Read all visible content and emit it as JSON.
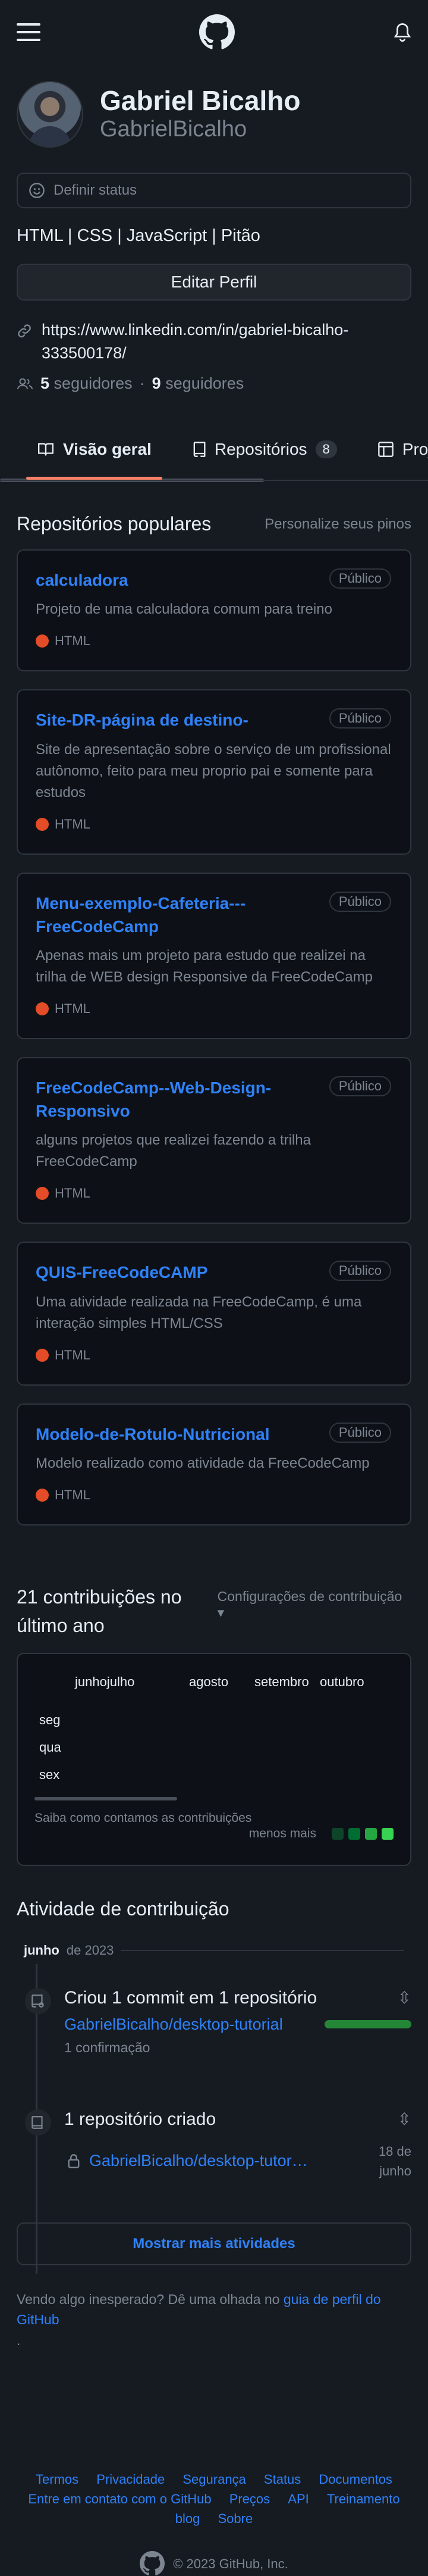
{
  "profile": {
    "name": "Gabriel Bicalho",
    "login": "GabrielBicalho",
    "status_placeholder": "Definir status",
    "bio": "HTML | CSS | JavaScript | Pitão",
    "edit_label": "Editar Perfil",
    "link_line1": "https://www.linkedin.com/in/gabriel-bicalho-",
    "link_line2": "333500178/",
    "followers_count": "5",
    "followers_label": "seguidores",
    "following_count": "9",
    "following_label": "seguidores"
  },
  "tabs": [
    {
      "label": "Visão geral",
      "icon": "book-icon"
    },
    {
      "label": "Repositórios",
      "icon": "repo-icon",
      "count": "8"
    },
    {
      "label": "Projetos",
      "icon": "table-icon"
    }
  ],
  "popular": {
    "title": "Repositórios populares",
    "customize": "Personalize seus pinos",
    "repos": [
      {
        "name": "calculadora",
        "visibility": "Público",
        "description": "Projeto de uma calculadora comum para treino",
        "language": "HTML"
      },
      {
        "name": "Site-DR-página de destino-",
        "visibility": "Público",
        "description": "Site de apresentação sobre o serviço de um profissional autônomo, feito para meu proprio pai e somente para estudos",
        "language": "HTML"
      },
      {
        "name": "Menu-exemplo-Cafeteria---FreeCodeCamp",
        "visibility": "Público",
        "description": "Apenas mais um projeto para estudo que realizei na trilha de WEB design Responsive da FreeCodeCamp",
        "language": "HTML"
      },
      {
        "name": "FreeCodeCamp--Web-Design-Responsivo",
        "visibility": "Público",
        "description": "alguns projetos que realizei fazendo a trilha FreeCodeCamp",
        "language": "HTML"
      },
      {
        "name": "QUIS-FreeCodeCAMP",
        "visibility": "Público",
        "description": "Uma atividade realizada na FreeCodeCamp, é uma interação simples HTML/CSS",
        "language": "HTML"
      },
      {
        "name": "Modelo-de-Rotulo-Nutricional",
        "visibility": "Público",
        "description": "Modelo realizado como atividade da FreeCodeCamp",
        "language": "HTML"
      }
    ]
  },
  "contributions": {
    "title": "21 contribuições no último ano",
    "settings": "Configurações de contribuição",
    "months": [
      "junhojulho",
      "agosto",
      "setembro",
      "outubro"
    ],
    "days": [
      "seg",
      "qua",
      "sex"
    ],
    "learn": "Saiba como contamos as contribuições",
    "less_more": "menos mais",
    "legend_colors": [
      "#0e4429",
      "#006d32",
      "#26a641",
      "#39d353"
    ]
  },
  "activity": {
    "title": "Atividade de contribuição",
    "month": "junho",
    "year": "de 2023",
    "commit_title": "Criou 1 commit em 1 repositório",
    "commit_repo": "GabrielBicalho/desktop-tutorial",
    "commit_sub": "1 confirmação",
    "commit_share": 1.0,
    "created_title": "1 repositório criado",
    "created_repo": "GabrielBicalho/desktop-tutor…",
    "created_date_1": "18 de",
    "created_date_2": "junho",
    "more_label": "Mostrar mais atividades"
  },
  "help": {
    "text": "Vendo algo inesperado? Dê uma olhada no ",
    "link": "guia de perfil do GitHub",
    "suffix": "."
  },
  "footer": {
    "links": [
      "Termos",
      "Privacidade",
      "Segurança",
      "Status",
      "Documentos",
      "Entre em contato com o GitHub",
      "Preços",
      "API",
      "Treinamento",
      "blog",
      "Sobre"
    ],
    "copyright": "© 2023 GitHub, Inc."
  }
}
